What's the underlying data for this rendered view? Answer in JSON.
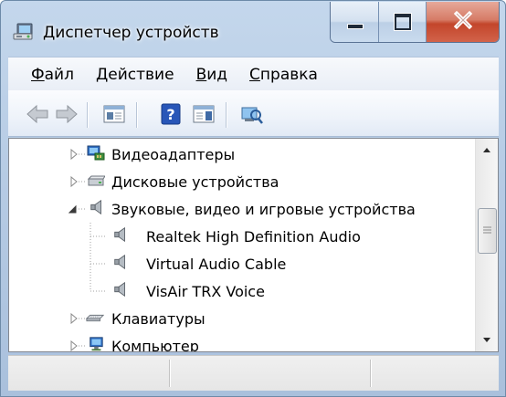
{
  "window": {
    "title": "Диспетчер устройств",
    "colors": {
      "frame": "#b6cbe4",
      "close": "#c3452b",
      "selection_line": "#a0a0a0"
    }
  },
  "caption_buttons": {
    "minimize": "minimize-icon",
    "maximize": "maximize-icon",
    "close": "close-icon"
  },
  "menu": {
    "items": [
      {
        "accel": "Ф",
        "rest": "айл"
      },
      {
        "accel": "Д",
        "rest": "ействие"
      },
      {
        "accel": "В",
        "rest": "ид"
      },
      {
        "accel": "С",
        "rest": "правка"
      }
    ]
  },
  "toolbar": {
    "icons": [
      "back-arrow-icon",
      "forward-arrow-icon",
      "properties-icon",
      "help-icon",
      "details-pane-icon",
      "scan-hardware-icon"
    ]
  },
  "tree": {
    "items": [
      {
        "label": "Видеоадаптеры",
        "icon": "display-adapter-icon",
        "expanded": false
      },
      {
        "label": "Дисковые устройства",
        "icon": "disk-drive-icon",
        "expanded": false
      },
      {
        "label": "Звуковые, видео и игровые устройства",
        "icon": "speaker-icon",
        "expanded": true
      },
      {
        "label": "Realtek High Definition Audio",
        "icon": "speaker-icon",
        "child": true
      },
      {
        "label": "Virtual Audio Cable",
        "icon": "speaker-icon",
        "child": true
      },
      {
        "label": "VisAir TRX Voice",
        "icon": "speaker-icon",
        "child": true
      },
      {
        "label": "Клавиатуры",
        "icon": "keyboard-icon",
        "expanded": false
      },
      {
        "label": "Компьютер",
        "icon": "computer-icon",
        "expanded": false
      }
    ]
  },
  "statusbar": {
    "panes": [
      "",
      "",
      ""
    ]
  }
}
